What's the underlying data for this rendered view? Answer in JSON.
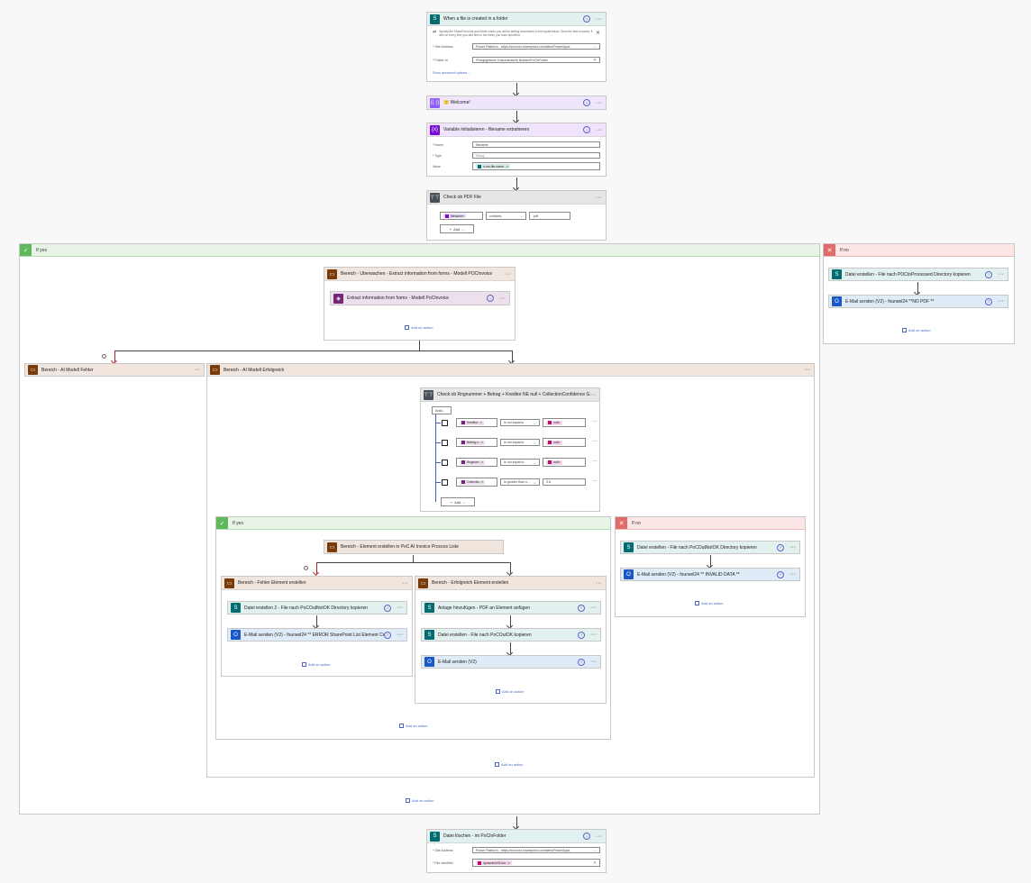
{
  "trigger": {
    "title": "When a file is created in a folder",
    "info_text": "Specify the SharePoint site and folder where you will be adding documents to the inputs below. Once the flow is saved, it will run every time you add files to the folder you have specified.",
    "site_label": "* Site Address",
    "site_value": "Power Platform - https://xxxxxxx.sharepoint.com/sites/PowerApps",
    "folder_label": "* Folder Id",
    "folder_value": "/Freigegebene Dokumente/AI Builder/PoCInFolder",
    "show_advanced": "Show advanced options"
  },
  "welcome": {
    "title": "Welcome!"
  },
  "initvar": {
    "title": "Variable initialisieren - filename extrahieren",
    "name_label": "* Name",
    "name_value": "filename",
    "type_label": "* Type",
    "type_value": "String",
    "value_label": "Value",
    "value_pill": "x-ms-file-name..."
  },
  "check_pdf": {
    "title": "Check ob PDF File",
    "operand": "filename",
    "operator": "contains",
    "value": ".pdf",
    "add": "Add"
  },
  "if_yes": {
    "label": "If yes"
  },
  "if_no": {
    "label": "If no",
    "action1": "Datei erstellen - File nach POCtoProcessed Directory kopieren",
    "action2": "E-Mail senden (V2) - fourwel24 **NO PDF **",
    "add_action": "Add an action"
  },
  "scope_extract": {
    "title": "Bereich - Überwachen - Extract information from forms - Modell POCInvoice",
    "inner": "Extract information from forms - Modell PoCInvoice",
    "add_action": "Add an action"
  },
  "scope_fehler": {
    "title": "Bereich - AI Modell Fehler"
  },
  "scope_erfolg": {
    "title": "Bereich - AI Modell Erfolgreich",
    "add_action": "Add an action"
  },
  "check_fields": {
    "title": "Check ob Rngnummer + Betrag + Kreditor NE null + CollectionConfidence GT0...",
    "and_label": "And",
    "rows": [
      {
        "field": "Kreditor...",
        "operator": "is not equal to",
        "value": "null"
      },
      {
        "field": "Betrag-v...",
        "operator": "is not equal to",
        "value": "null"
      },
      {
        "field": "Rngnum...",
        "operator": "is not equal to",
        "value": "null"
      },
      {
        "field": "Collectio...",
        "operator": "is greater than o...",
        "value": "0.8"
      }
    ],
    "add": "Add"
  },
  "inner_yes": {
    "label": "If yes",
    "scope_element": "Bereich - Element erstellen in PoC AI Invoice Process Liste",
    "add_action": "Add an action"
  },
  "inner_no": {
    "label": "If no",
    "action1": "Datei erstellen - File nach PoCOutNotOK Directory kopieren",
    "action2": "E-Mail senden (V2) - fourwel24 ** INVALID DATA **",
    "add_action": "Add an action"
  },
  "scope_fehler_element": {
    "title": "Bereich - Fehler Element erstellen",
    "action1": "Datei erstellen 2 - File nach PoCOutNotOK Directory kopieren",
    "action2": "E-Mail senden (V2) - fourwel24 ** ERROR SharePoint List Element Creatio...",
    "add_action": "Add an action"
  },
  "scope_erfolg_element": {
    "title": "Bereich - Erfolgreich Element erstellen",
    "action1": "Anlage hinzufügen - PDF an Element anfügen",
    "action2": "Datei erstellen - File nach PoCOutOK kopieren",
    "action3": "E-Mail senden (V2)",
    "add_action": "Add an action"
  },
  "outer_add_action": "Add an action",
  "delete_file": {
    "title": "Datei löschen - im PoCInFolder",
    "site_label": "* Site Address",
    "site_value": "Power Platform - https://xxxxxxx.sharepoint.com/sites/PowerApps",
    "file_label": "* File Identifier",
    "file_pill": "dynamicUrlCom..."
  },
  "colors": {
    "sharepoint": "#036c70",
    "outlook": "#1a58c7",
    "variable": "#770bd6",
    "control": "#484f58",
    "scope": "#7a3b0a",
    "aibuilder": "#742774",
    "welcome": "#8b5cf6"
  }
}
